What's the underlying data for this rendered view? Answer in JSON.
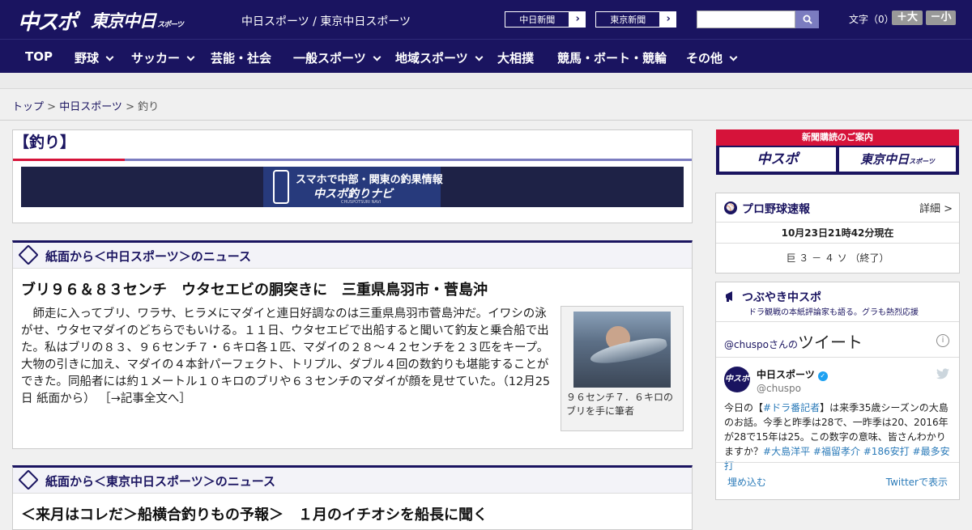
{
  "header": {
    "logo_chuspo": "中スポ",
    "logo_tokyo": "東京中日",
    "logo_tokyo_small": "スポーツ",
    "site_links": "中日スポーツ / 東京中日スポーツ",
    "btn_chunichi": "中日新聞",
    "btn_tokyo": "東京新聞",
    "arrow": "›",
    "font_label": "文字（0）",
    "font_plus": "＋大",
    "font_minus": "－小"
  },
  "nav": {
    "items": [
      "TOP",
      "野球",
      "サッカー",
      "芸能・社会",
      "一般スポーツ",
      "地域スポーツ",
      "大相撲",
      "競馬・ボート・競輪",
      "その他"
    ]
  },
  "breadcrumb": {
    "top": "トップ",
    "sep": " > ",
    "chunichi": "中日スポーツ",
    "current": "釣り"
  },
  "page": {
    "title": "【釣り】",
    "banner_line1": "スマホで中部・関東の釣果情報",
    "banner_line2": "中スポ釣りナビ",
    "banner_line3": "CHUSPOTSURI NAVI"
  },
  "section1": {
    "title": "紙面から＜中日スポーツ＞のニュース",
    "headline": "ブリ９６＆８３センチ　ウタセエビの胴突きに　三重県鳥羽市・菅島沖",
    "body": "師走に入ってブリ、ワラサ、ヒラメにマダイと連日好調なのは三重県鳥羽市菅島沖だ。イワシの泳がせ、ウタセマダイのどちらでもいける。１１日、ウタセエビで出船すると聞いて釣友と乗合船で出た。私はブリの８３、９６センチ７・６キロ各１匹、マダイの２８～４２センチを２３匹をキープ。大物の引きに加え、マダイの４本針パーフェクト、トリプル、ダブル４回の数釣りも堪能することができた。同船者には約１メートル１０キロのブリや６３センチのマダイが顔を見せていた。（12月25日 紙面から）",
    "more": "［→記事全文へ］",
    "caption": "９６センチ７．６キロのブリを手に筆者"
  },
  "section2": {
    "title": "紙面から＜東京中日スポーツ＞のニュース",
    "headline": "＜来月はコレだ＞船横合釣りもの予報＞　１月のイチオシを船長に聞く"
  },
  "sidebar": {
    "subscribe_title": "新聞購読のご案内",
    "sub_chuspo": "中スポ",
    "sub_tokyo": "東京中日",
    "sub_tokyo_small": "スポーツ",
    "pro_title": "プロ野球速報",
    "pro_detail": "詳細 >",
    "pro_time": "10月23日21時42分現在",
    "pro_score": "巨 ３ － ４ ソ （終了）",
    "tweet_title": "つぶやき中スポ",
    "tweet_sub": "ドラ観戦の本紙評論家も語る。グラも熱烈応援",
    "tweet_handle_prefix": "@chuspo",
    "tweet_handle_san": "さんの",
    "tweet_heading": "ツイート",
    "tweet_name": "中日スポーツ",
    "tweet_user": "@chuspo",
    "tweet_avatar": "中スポ",
    "tweet_text_1": "今日の【",
    "tweet_tag_1": "#ドラ番記者",
    "tweet_text_2": "】は来季35歳シーズンの大島のお話。今季と昨季は28で、一昨季は20、2016年が28で15年は25。この数字の意味、皆さんわかりますか？",
    "tweet_tags_2": "#大島洋平 #福留孝介 #186安打 #最多安打",
    "tweet_embed": "埋め込む",
    "tweet_view": "Twitterで表示"
  },
  "colors": {
    "brand": "#1a1460",
    "accent_red": "#d6133a",
    "accent_lavender": "#7b7cc0",
    "twitter": "#1da1f2"
  }
}
